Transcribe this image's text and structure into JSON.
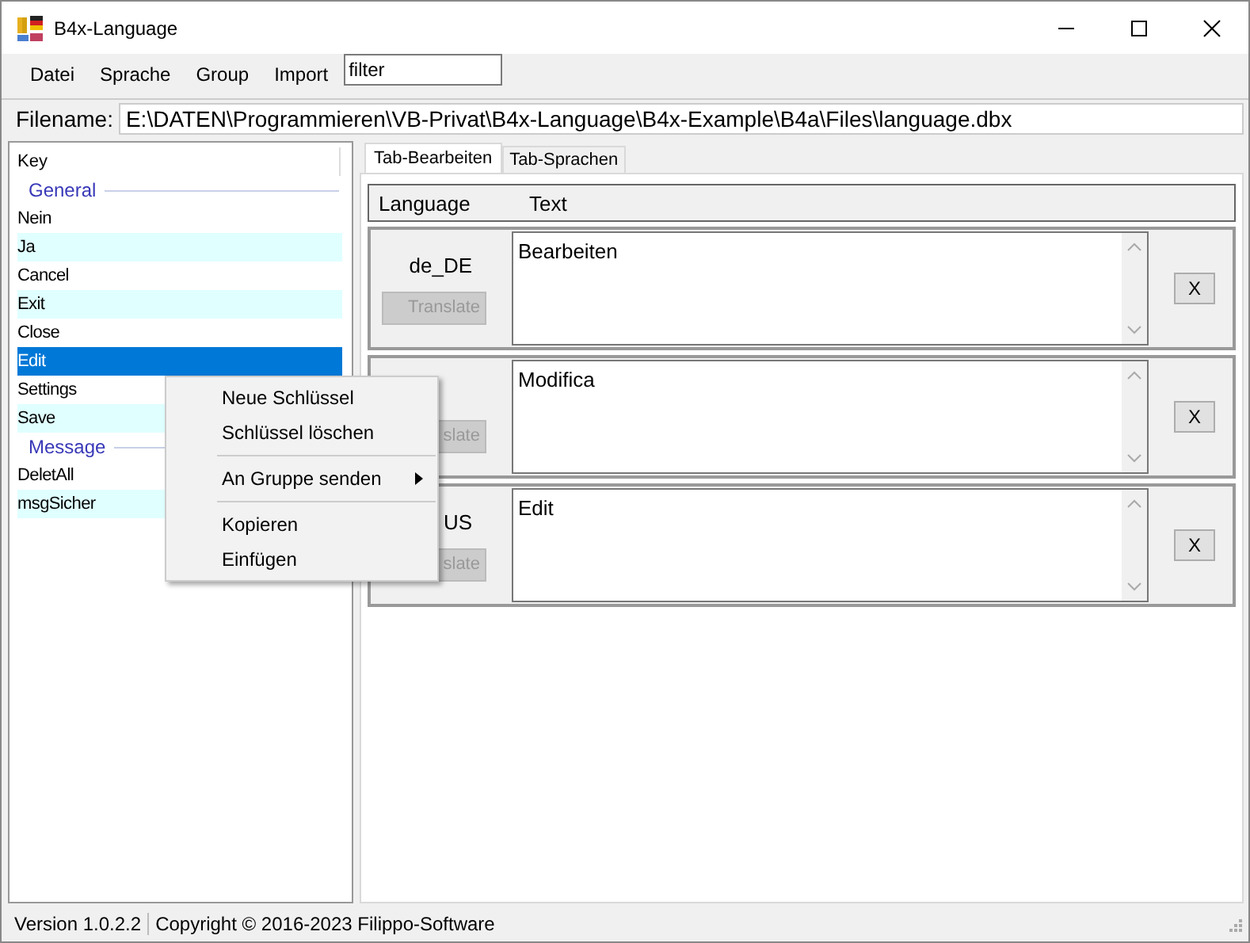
{
  "window": {
    "title": "B4x-Language"
  },
  "menu": [
    {
      "label": "Datei"
    },
    {
      "label": "Sprache"
    },
    {
      "label": "Group"
    },
    {
      "label": "Import"
    }
  ],
  "filter": {
    "value": "filter"
  },
  "filename": {
    "label": "Filename:",
    "value": "E:\\DATEN\\Programmieren\\VB-Privat\\B4x-Language\\B4x-Example\\B4a\\Files\\language.dbx"
  },
  "key_list": {
    "header": "Key",
    "groups": [
      {
        "label": "General",
        "children": [
          {
            "label": "Nein",
            "selected": false
          },
          {
            "label": "Ja",
            "selected": false
          },
          {
            "label": "Cancel",
            "selected": false
          },
          {
            "label": "Exit",
            "selected": false
          },
          {
            "label": "Close",
            "selected": false
          },
          {
            "label": "Edit",
            "selected": true
          },
          {
            "label": "Settings",
            "selected": false
          },
          {
            "label": "Save",
            "selected": false
          }
        ]
      },
      {
        "label": "Message",
        "children": [
          {
            "label": "DeletAll",
            "selected": false
          },
          {
            "label": "msgSicher",
            "selected": false
          }
        ]
      }
    ]
  },
  "tabs": [
    {
      "label": "Tab-Bearbeiten",
      "selected": true
    },
    {
      "label": "Tab-Sprachen",
      "selected": false
    }
  ],
  "columns": [
    "Language",
    "Text"
  ],
  "entries": [
    {
      "language": "de_DE",
      "translate": {
        "label": "Translate",
        "disabled": true
      },
      "text": "Bearbeiten",
      "delete": "X"
    },
    {
      "translate": {
        "label": "slate",
        "disabled": true
      },
      "text": "Modifica",
      "delete": "X"
    },
    {
      "language": "US",
      "translate": {
        "label": "slate",
        "disabled": true
      },
      "text": "Edit",
      "delete": "X"
    }
  ],
  "context_menu": [
    {
      "kind": "item",
      "label": "Neue Schlüssel"
    },
    {
      "kind": "item",
      "label": "Schlüssel löschen"
    },
    {
      "kind": "separator"
    },
    {
      "kind": "submenu",
      "label": "An Gruppe senden"
    },
    {
      "kind": "separator"
    },
    {
      "kind": "item",
      "label": "Kopieren"
    },
    {
      "kind": "item",
      "label": "Einfügen"
    }
  ],
  "status_bar": [
    "Version 1.0.2.2",
    "Copyright ©  2016-2023 Filippo-Software"
  ]
}
